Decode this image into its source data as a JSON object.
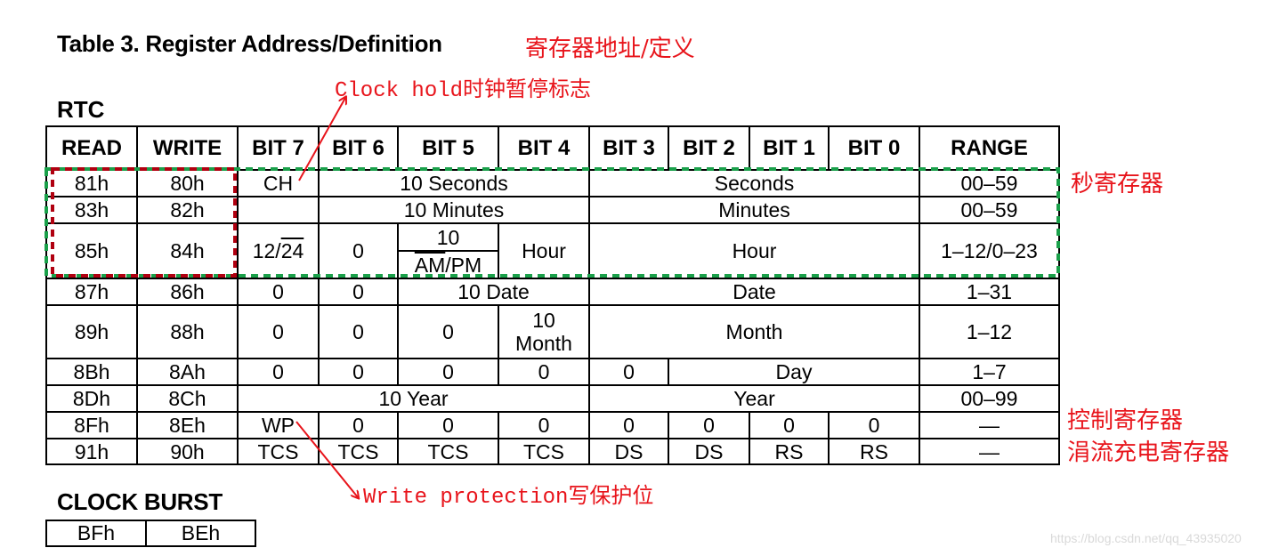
{
  "title": "Table 3. Register Address/Definition",
  "title_annotation": "寄存器地址/定义",
  "section_rtc": "RTC",
  "section_clock_burst": "CLOCK BURST",
  "annotations": {
    "clock_hold": "Clock hold时钟暂停标志",
    "write_protection": "Write protection写保护位",
    "seconds_register": "秒寄存器",
    "control_register": "控制寄存器",
    "trickle_charge_register": "涓流充电寄存器"
  },
  "watermark": "https://blog.csdn.net/qq_43935020",
  "colors": {
    "annotation_red": "#e8141b",
    "highlight_green": "#1aa04a",
    "highlight_darkred": "#b00010"
  },
  "table": {
    "headers": [
      "READ",
      "WRITE",
      "BIT 7",
      "BIT 6",
      "BIT 5",
      "BIT 4",
      "BIT 3",
      "BIT 2",
      "BIT 1",
      "BIT 0",
      "RANGE"
    ],
    "rows": [
      {
        "read": "81h",
        "write": "80h",
        "bit7": "CH",
        "bits6_4": "10 Seconds",
        "bits3_0": "Seconds",
        "range": "00–59"
      },
      {
        "read": "83h",
        "write": "82h",
        "bit7": "",
        "bits6_4": "10 Minutes",
        "bits3_0": "Minutes",
        "range": "00–59"
      },
      {
        "read": "85h",
        "write": "84h",
        "bit7_pre": "12/",
        "bit7_over": "24",
        "bit6": "0",
        "bit5_top": "10",
        "bit5_bottom_over": "AM",
        "bit5_bottom_rest": "/PM",
        "bit4": "Hour",
        "bits3_0": "Hour",
        "range": "1–12/0–23"
      },
      {
        "read": "87h",
        "write": "86h",
        "bit7": "0",
        "bit6": "0",
        "bits5_4": "10 Date",
        "bits3_0": "Date",
        "range": "1–31"
      },
      {
        "read": "89h",
        "write": "88h",
        "bit7": "0",
        "bit6": "0",
        "bit5": "0",
        "bit4_l1": "10",
        "bit4_l2": "Month",
        "bits3_0": "Month",
        "range": "1–12"
      },
      {
        "read": "8Bh",
        "write": "8Ah",
        "bit7": "0",
        "bit6": "0",
        "bit5": "0",
        "bit4": "0",
        "bit3": "0",
        "bits2_0": "Day",
        "range": "1–7"
      },
      {
        "read": "8Dh",
        "write": "8Ch",
        "bits7_4": "10 Year",
        "bits3_0": "Year",
        "range": "00–99"
      },
      {
        "read": "8Fh",
        "write": "8Eh",
        "bit7": "WP",
        "bit6": "0",
        "bit5": "0",
        "bit4": "0",
        "bit3": "0",
        "bit2": "0",
        "bit1": "0",
        "bit0": "0",
        "range": "—"
      },
      {
        "read": "91h",
        "write": "90h",
        "bit7": "TCS",
        "bit6": "TCS",
        "bit5": "TCS",
        "bit4": "TCS",
        "bit3": "DS",
        "bit2": "DS",
        "bit1": "RS",
        "bit0": "RS",
        "range": "—"
      }
    ]
  },
  "clock_burst": {
    "read": "BFh",
    "write": "BEh"
  }
}
